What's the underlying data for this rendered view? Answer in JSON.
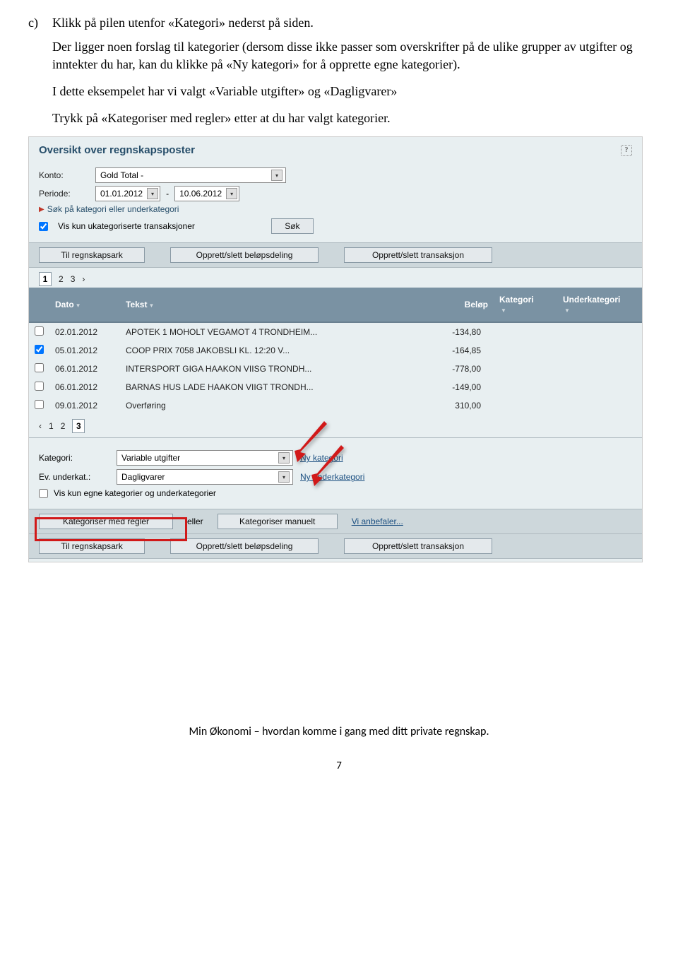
{
  "doc": {
    "list_marker": "c)",
    "para1": "Klikk på pilen utenfor «Kategori» nederst på siden.",
    "para2": "Der ligger noen forslag til kategorier (dersom disse ikke passer som overskrifter på de ulike grupper av utgifter og inntekter du har, kan du klikke på «Ny kategori» for å opprette egne kategorier).",
    "para3": "I dette eksempelet har vi valgt «Variable utgifter» og «Dagligvarer»",
    "para4": "Trykk på «Kategoriser med regler» etter at du har valgt kategorier.",
    "footer": "Min Økonomi – hvordan komme i gang med ditt private regnskap.",
    "page_number": "7"
  },
  "ui": {
    "heading": "Oversikt over regnskapsposter",
    "konto_label": "Konto:",
    "konto_value": "Gold Total -",
    "periode_label": "Periode:",
    "periode_from": "01.01.2012",
    "periode_sep": "-",
    "periode_to": "10.06.2012",
    "search_link": "Søk på kategori eller underkategori",
    "vis_kun_ukat": "Vis kun ukategoriserte transaksjoner",
    "sok_btn": "Søk",
    "til_regnskapsark": "Til regnskapsark",
    "opprett_slett_belop": "Opprett/slett beløpsdeling",
    "opprett_slett_trans": "Opprett/slett transaksjon",
    "pager_top": [
      "1",
      "2",
      "3",
      "›"
    ],
    "pager_bottom": [
      "‹",
      "1",
      "2",
      "3"
    ],
    "col_dato": "Dato",
    "col_tekst": "Tekst",
    "col_belop": "Beløp",
    "col_kategori": "Kategori",
    "col_underkat": "Underkategori",
    "rows": [
      {
        "checked": false,
        "dato": "02.01.2012",
        "tekst": "APOTEK 1 MOHOLT VEGAMOT 4 TRONDHEIM...",
        "belop": "-134,80"
      },
      {
        "checked": true,
        "dato": "05.01.2012",
        "tekst": "COOP PRIX 7058 JAKOBSLI KL. 12:20 V...",
        "belop": "-164,85"
      },
      {
        "checked": false,
        "dato": "06.01.2012",
        "tekst": "INTERSPORT GIGA HAAKON VIISG TRONDH...",
        "belop": "-778,00"
      },
      {
        "checked": false,
        "dato": "06.01.2012",
        "tekst": "BARNAS HUS LADE HAAKON VIIGT TRONDH...",
        "belop": "-149,00"
      },
      {
        "checked": false,
        "dato": "09.01.2012",
        "tekst": "Overføring",
        "belop": "310,00"
      }
    ],
    "kategori_label": "Kategori:",
    "kategori_value": "Variable utgifter",
    "ny_kategori": "Ny kategori",
    "underkat_label": "Ev. underkat.:",
    "underkat_value": "Dagligvarer",
    "ny_underkategori": "Ny underkategori",
    "vis_kun_egne": "Vis kun egne kategorier og underkategorier",
    "kat_med_regler": "Kategoriser med regler",
    "eller": "eller",
    "kat_manuelt": "Kategoriser manuelt",
    "vi_anbefaler": "Vi anbefaler..."
  }
}
